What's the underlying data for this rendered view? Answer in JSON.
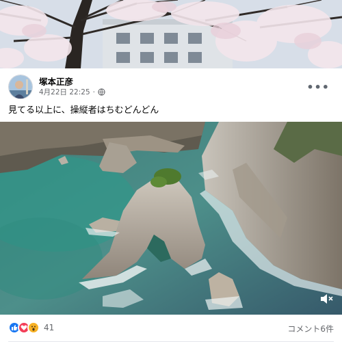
{
  "post": {
    "author": "塚本正彦",
    "timestamp": "4月22日 22:25",
    "audience_icon": "globe-icon",
    "more_icon": "more-options-icon",
    "more_label": "•••",
    "text": "見てる以上に、操縦者はちむどんどん"
  },
  "media": {
    "mute_icon": "speaker-muted-icon"
  },
  "engagement": {
    "reaction_icons": [
      "like-icon",
      "love-icon",
      "wow-icon"
    ],
    "reaction_count": "41",
    "comments_label": "コメント6件"
  },
  "colors": {
    "like": "#1877f2",
    "love": "#f33e58",
    "wow": "#f7b125",
    "secondary_text": "#65676b"
  }
}
